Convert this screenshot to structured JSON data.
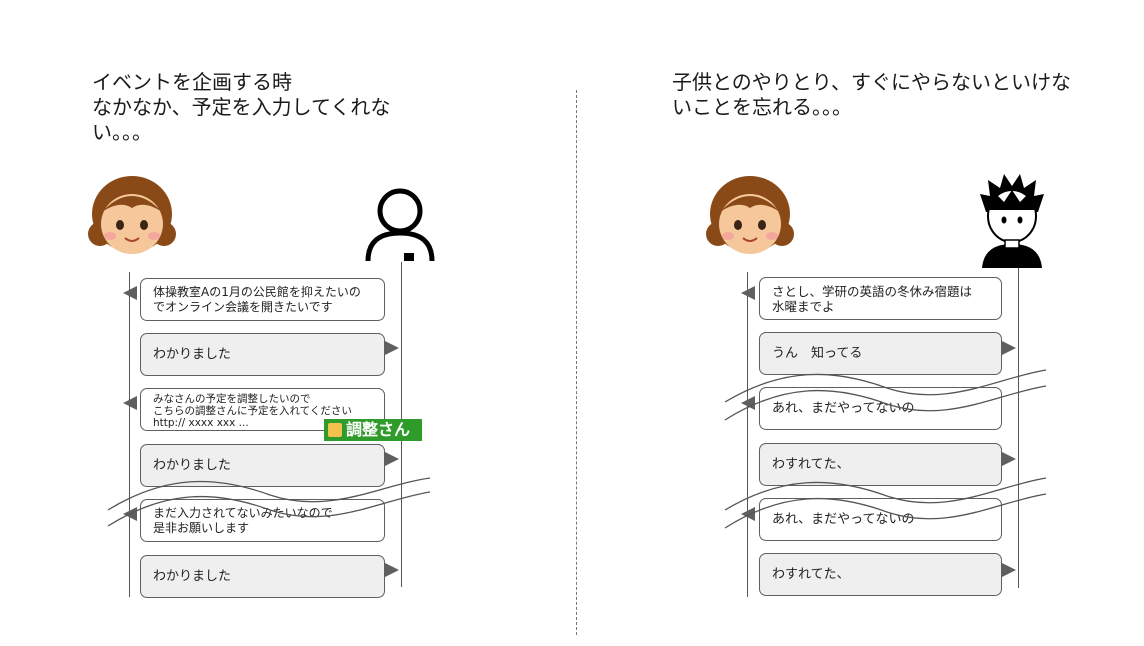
{
  "left": {
    "heading": "イベントを企画する時\nなかなか、予定を入力してくれない。。。",
    "messages": [
      {
        "text": "体操教室Aの1月の公民館を抑えたいのでオンライン会議を開きたいです",
        "side": "left"
      },
      {
        "text": "わかりました",
        "side": "right"
      },
      {
        "text": "みなさんの予定を調整したいので\nこちらの調整さんに予定を入れてください\nhttp:// xxxx xxx ...",
        "side": "left"
      },
      {
        "text": "わかりました",
        "side": "right"
      },
      {
        "text": "まだ入力されてないみたいなので\n是非お願いします",
        "side": "left"
      },
      {
        "text": "わかりました",
        "side": "right"
      }
    ],
    "logo_text": "調整さん"
  },
  "right": {
    "heading": "子供とのやりとり、すぐにやらないといけないことを忘れる。。。",
    "messages": [
      {
        "text": "さとし、学研の英語の冬休み宿題は　水曜までよ",
        "side": "left"
      },
      {
        "text": "うん　知ってる",
        "side": "right"
      },
      {
        "text": "あれ、まだやってないの",
        "side": "left"
      },
      {
        "text": "わすれてた、",
        "side": "right"
      },
      {
        "text": "あれ、まだやってないの",
        "side": "left"
      },
      {
        "text": "わすれてた、",
        "side": "right"
      }
    ]
  },
  "colors": {
    "skin": "#f6c79a",
    "hair": "#8a4a17",
    "logo_green": "#2e9b2a",
    "reply_fill": "#efefef"
  }
}
